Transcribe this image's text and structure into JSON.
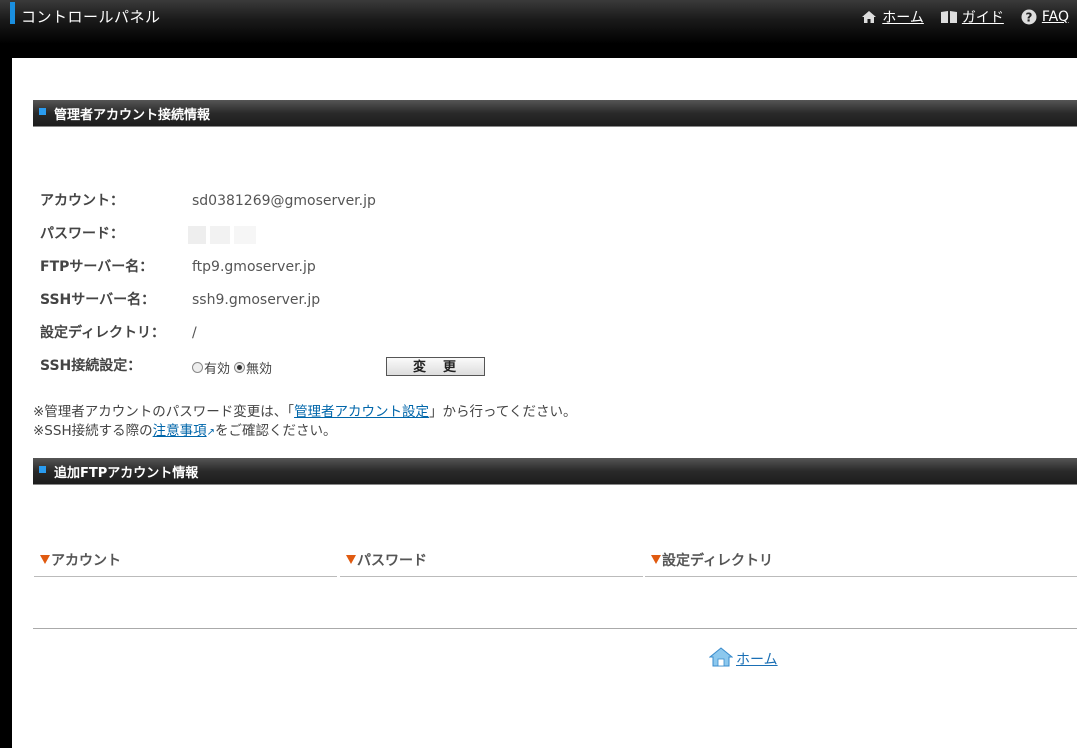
{
  "header": {
    "title": "コントロールパネル",
    "nav": [
      {
        "label": "ホーム",
        "icon": "home-icon"
      },
      {
        "label": "ガイド",
        "icon": "book-icon"
      },
      {
        "label": "FAQ",
        "icon": "help-icon"
      }
    ]
  },
  "admin_section": {
    "title": "管理者アカウント接続情報",
    "fields": [
      {
        "label": "アカウント：",
        "value": "sd0381269@gmoserver.jp"
      },
      {
        "label": "パスワード：",
        "value": ""
      },
      {
        "label": "FTPサーバー名：",
        "value": "ftp9.gmoserver.jp"
      },
      {
        "label": "SSHサーバー名：",
        "value": "ssh9.gmoserver.jp"
      },
      {
        "label": "設定ディレクトリ：",
        "value": "/"
      },
      {
        "label": "SSH接続設定：",
        "value": ""
      }
    ],
    "ssh_options": [
      {
        "label": "有効",
        "selected": false
      },
      {
        "label": "無効",
        "selected": true
      }
    ],
    "change_button": "変　更",
    "note1_prefix": "※管理者アカウントのパスワード変更は、「",
    "note1_link": "管理者アカウント設定",
    "note1_suffix": "」から行ってください。",
    "note2_prefix": "※SSH接続する際の",
    "note2_link": "注意事項",
    "note2_suffix": "をご確認ください。"
  },
  "ftp_section": {
    "title": "追加FTPアカウント情報",
    "columns": [
      "アカウント",
      "パスワード",
      "設定ディレクトリ"
    ]
  },
  "footer": {
    "home_label": "ホーム"
  },
  "colors": {
    "accent": "#1a8fe0",
    "link": "#0066aa",
    "column_marker": "#e05a10"
  }
}
